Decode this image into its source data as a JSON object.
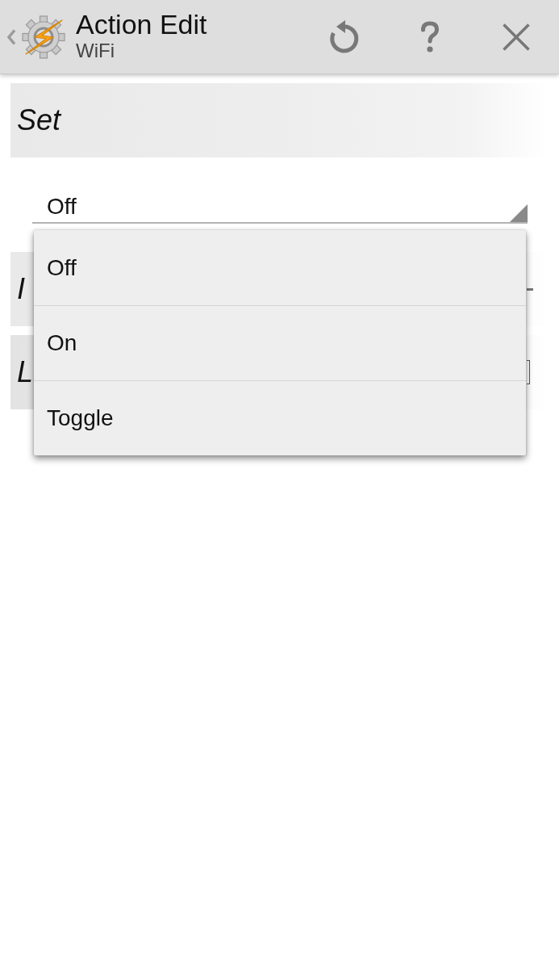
{
  "action_bar": {
    "title": "Action Edit",
    "subtitle": "WiFi"
  },
  "parameters": [
    {
      "kind": "spinner",
      "label": "Set",
      "value": "Off"
    },
    {
      "kind": "dash",
      "label": "I"
    },
    {
      "kind": "bracket",
      "label": "L"
    }
  ],
  "dropdown_menu": {
    "options": [
      {
        "label": "Off"
      },
      {
        "label": "On"
      },
      {
        "label": "Toggle"
      }
    ]
  }
}
